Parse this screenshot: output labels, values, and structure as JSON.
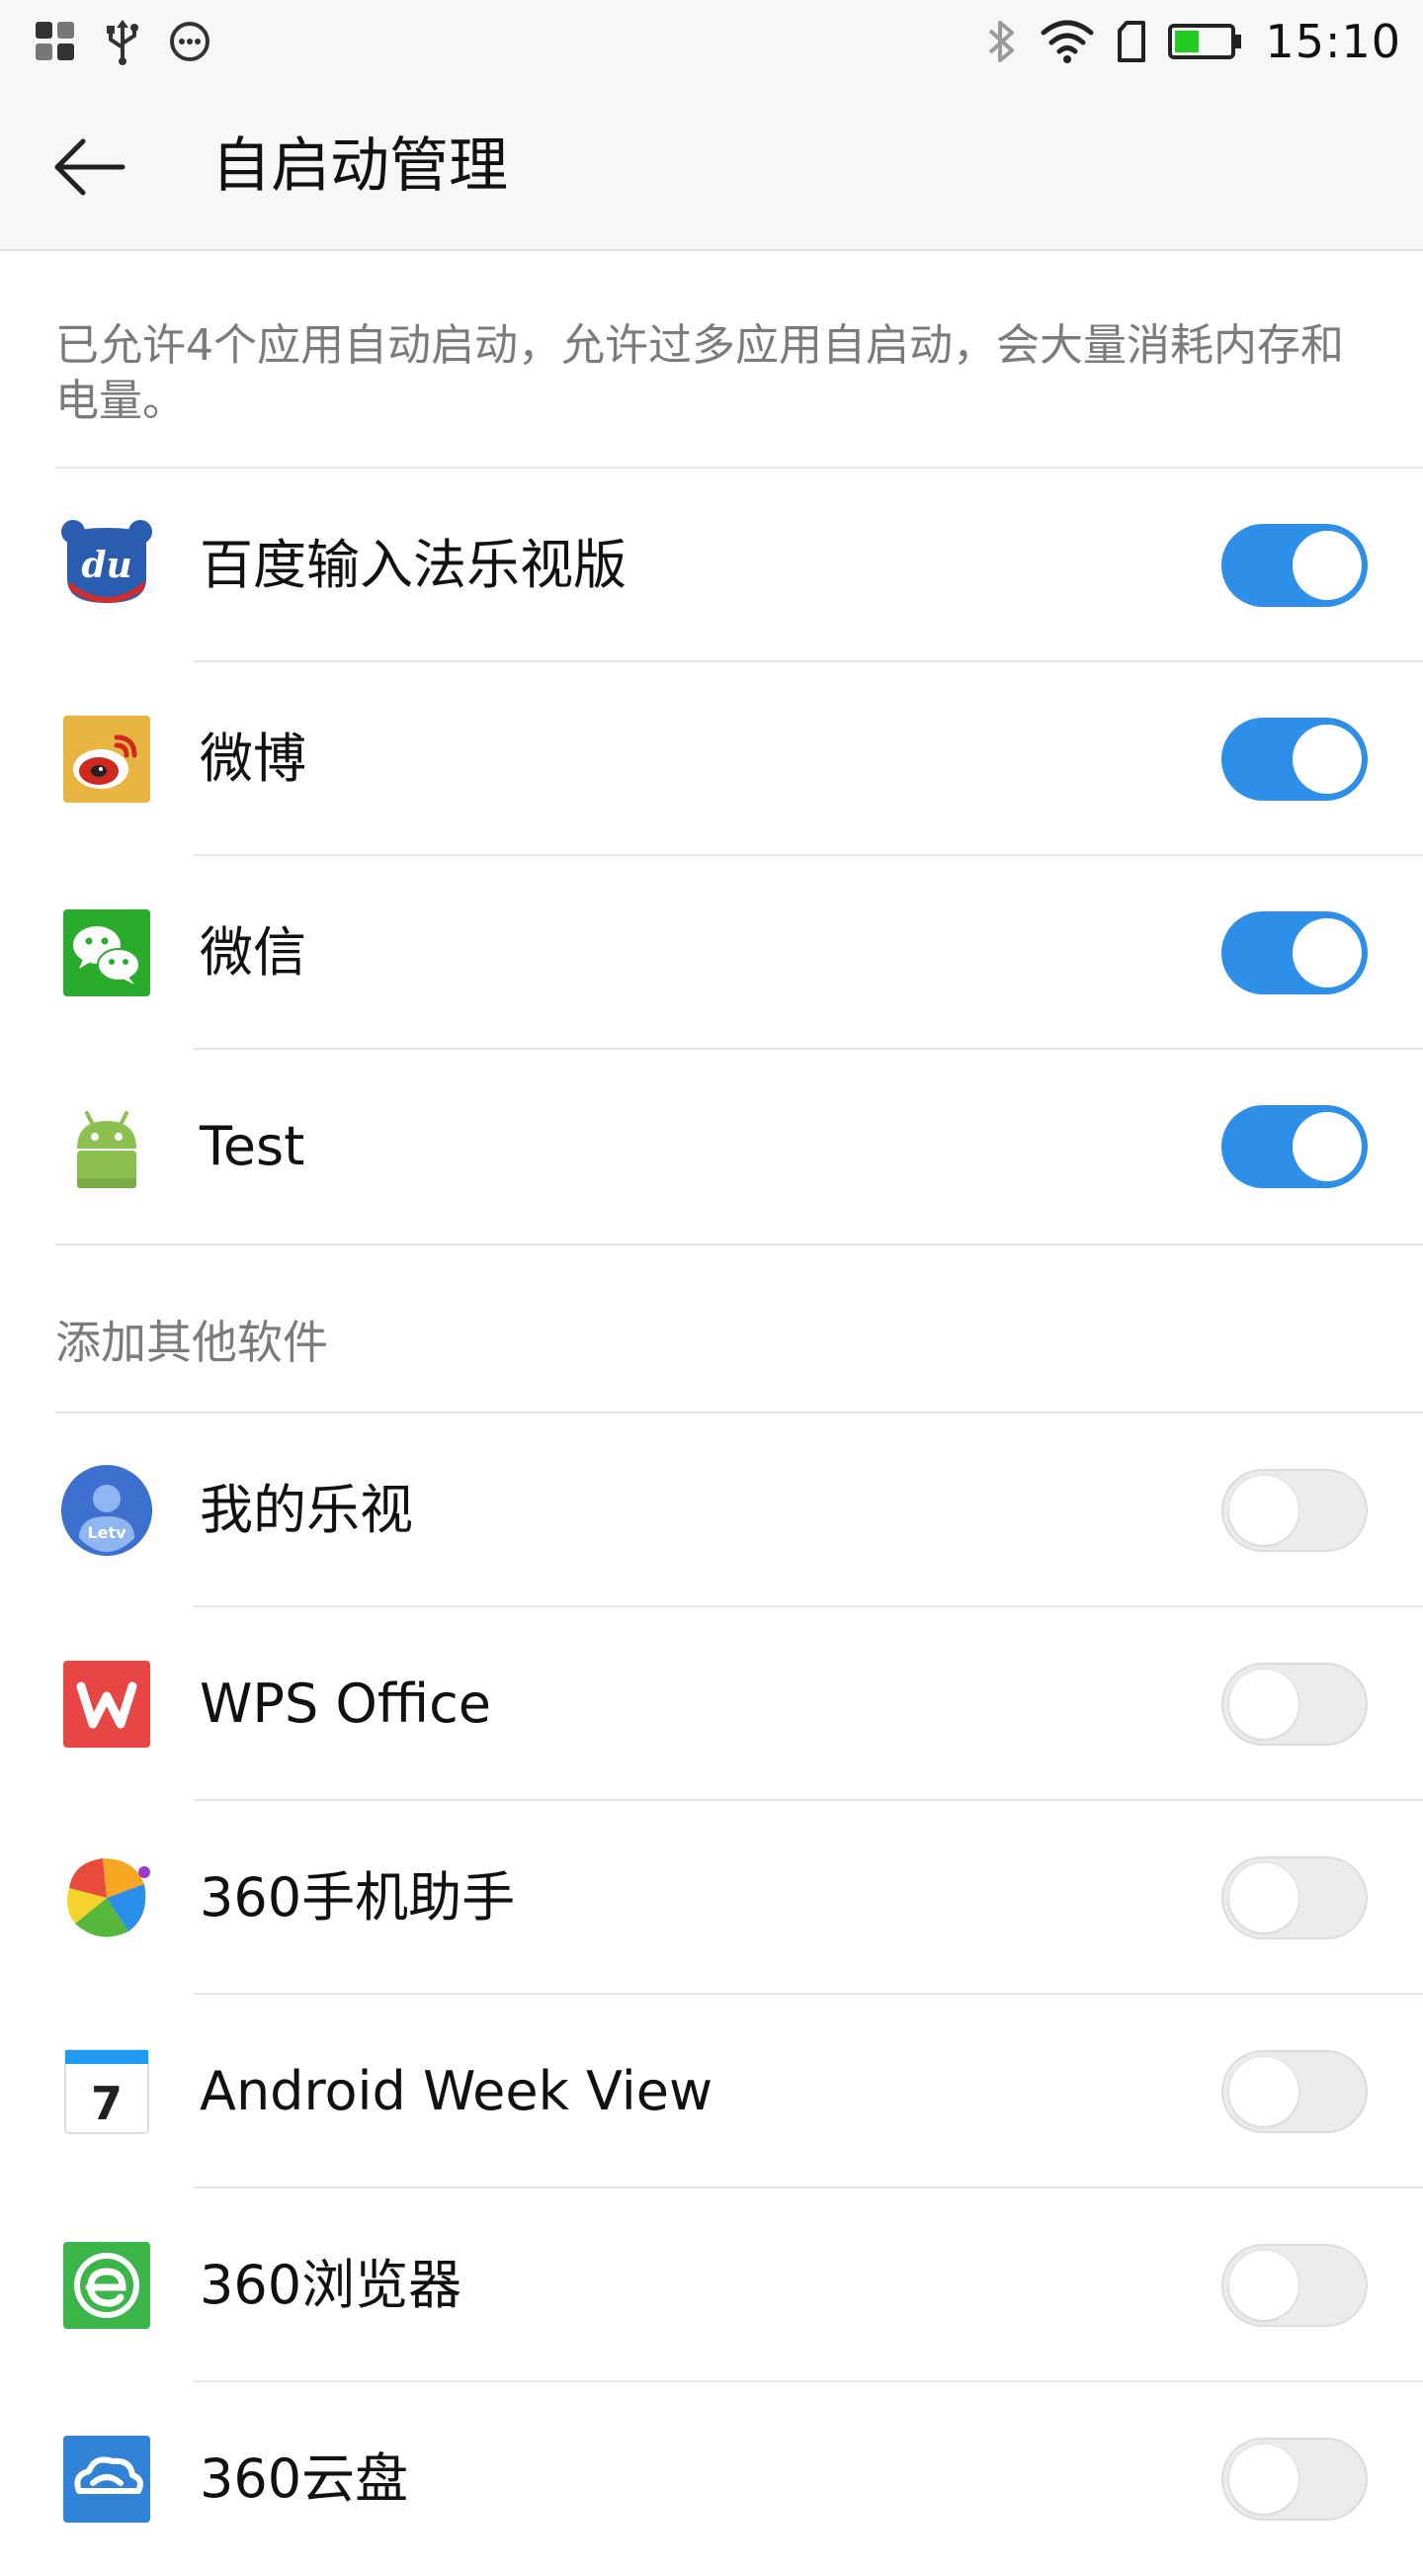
{
  "status_bar": {
    "time": "15:10",
    "battery_color": "#22cc22"
  },
  "header": {
    "title": "自启动管理"
  },
  "description": "已允许4个应用自动启动，允许过多应用自启动，会大量消耗内存和电量。",
  "allowed_apps": [
    {
      "name": "百度输入法乐视版",
      "icon": "baidu-input-icon",
      "enabled": true
    },
    {
      "name": "微博",
      "icon": "weibo-icon",
      "enabled": true
    },
    {
      "name": "微信",
      "icon": "wechat-icon",
      "enabled": true
    },
    {
      "name": "Test",
      "icon": "android-icon",
      "enabled": true
    }
  ],
  "other_section_title": "添加其他软件",
  "other_apps": [
    {
      "name": "我的乐视",
      "icon": "letv-icon",
      "enabled": false
    },
    {
      "name": "WPS Office",
      "icon": "wps-icon",
      "enabled": false
    },
    {
      "name": "360手机助手",
      "icon": "360-assistant-icon",
      "enabled": false
    },
    {
      "name": "Android Week View",
      "icon": "calendar-icon",
      "icon_text": "7",
      "enabled": false
    },
    {
      "name": "360浏览器",
      "icon": "360-browser-icon",
      "enabled": false
    },
    {
      "name": "360云盘",
      "icon": "360-cloud-icon",
      "enabled": false
    }
  ],
  "accent_color": "#2d8fe8"
}
